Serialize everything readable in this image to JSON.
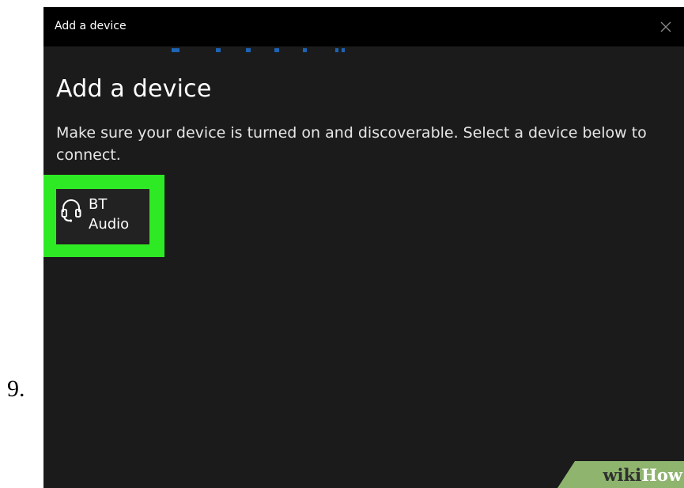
{
  "step": {
    "number": "9."
  },
  "window": {
    "title": "Add a device",
    "heading": "Add a device",
    "description": "Make sure your device is turned on and discoverable. Select a device below to connect.",
    "devices": [
      {
        "icon": "headset-icon",
        "name": "BT Audio",
        "highlighted": true
      }
    ]
  },
  "watermark": {
    "prefix": "wiki",
    "suffix": "How"
  },
  "colors": {
    "window_bg": "#1b1b1b",
    "titlebar_bg": "#000000",
    "highlight": "#2eea24",
    "tile_bg": "#222222",
    "accent_blue": "#1e64b4"
  }
}
